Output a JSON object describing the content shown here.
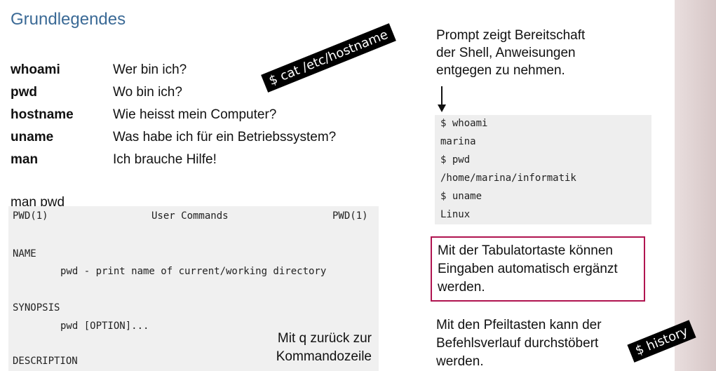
{
  "title": "Grundlegendes",
  "commands": [
    {
      "name": "whoami",
      "desc": "Wer bin ich?"
    },
    {
      "name": "pwd",
      "desc": "Wo bin ich?"
    },
    {
      "name": "hostname",
      "desc": "Wie heisst mein Computer?"
    },
    {
      "name": "uname",
      "desc": "Was habe ich für ein Betriebssystem?"
    },
    {
      "name": "man",
      "desc": "Ich brauche Hilfe!"
    }
  ],
  "man_label": "man pwd",
  "man_page": {
    "header_left": "PWD(1)",
    "header_center": "User Commands",
    "header_right": "PWD(1)",
    "name_heading": "NAME",
    "name_text": "pwd - print name of current/working directory",
    "synopsis_heading": "SYNOPSIS",
    "synopsis_text": "pwd [OPTION]...",
    "description_heading": "DESCRIPTION",
    "quit_note_line1": "Mit q zurück zur",
    "quit_note_line2": "Kommandozeile"
  },
  "sticker_cat": "$ cat /etc/hostname",
  "sticker_history": "$ history",
  "prompt_note": [
    "Prompt zeigt Bereitschaft",
    "der Shell, Anweisungen",
    "entgegen zu nehmen."
  ],
  "terminal_lines": [
    "$ whoami",
    "marina",
    "$ pwd",
    "/home/marina/informatik",
    "$ uname",
    "Linux"
  ],
  "tab_note": [
    "Mit der Tabulatortaste können",
    "Eingaben automatisch ergänzt",
    "werden."
  ],
  "arrow_note": [
    "Mit den Pfeiltasten kann der",
    "Befehlsverlauf durchstöbert",
    "werden."
  ],
  "colors": {
    "title": "#3b6a96",
    "tip_border": "#b01450"
  }
}
